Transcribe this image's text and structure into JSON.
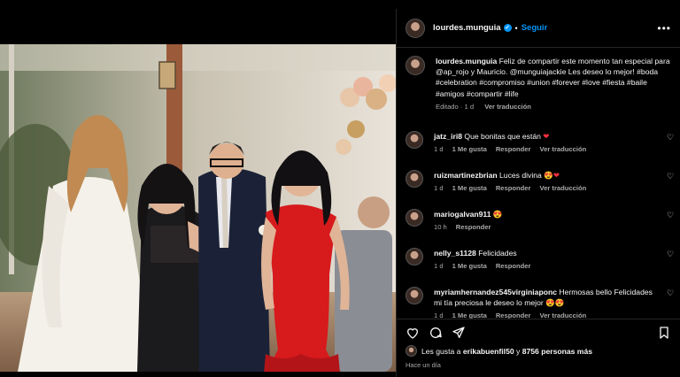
{
  "post": {
    "username": "lourdes.munguia",
    "follow_label": "Seguir",
    "more_label": "•••",
    "separator": "•",
    "caption": {
      "username": "lourdes.munguia",
      "text": "Feliz de compartir este momento tan especial para @ap_rojo y Mauricio. @munguiajackie Les deseo lo mejor! #boda #celebration #compromiso #union #forever #love #fiesta #baile #amigos #compartir #life",
      "edited": "Editado · 1 d",
      "translation": "Ver traducción"
    }
  },
  "comments": [
    {
      "username": "jatz_iri8",
      "text": "Que bonitas que están",
      "emoji": "❤",
      "time": "1 d",
      "likes": "1 Me gusta",
      "reply": "Responder",
      "translation": "Ver traducción"
    },
    {
      "username": "ruizmartinezbrian",
      "text": "Luces divina",
      "emoji": "😍❤",
      "time": "1 d",
      "likes": "1 Me gusta",
      "reply": "Responder",
      "translation": "Ver traducción"
    },
    {
      "username": "mariogalvan911",
      "text": "",
      "emoji": "😍",
      "time": "10 h",
      "likes": "",
      "reply": "Responder",
      "translation": ""
    },
    {
      "username": "nelly_s1128",
      "text": "Felicidades",
      "emoji": "",
      "time": "1 d",
      "likes": "1 Me gusta",
      "reply": "Responder",
      "translation": ""
    },
    {
      "username": "myriamhernandez545virginiaponc",
      "text": "Hermosas bello Felicidades mi tía preciosa le deseo lo mejor",
      "emoji": "😍😍",
      "time": "1 d",
      "likes": "1 Me gusta",
      "reply": "Responder",
      "translation": "Ver traducción"
    }
  ],
  "likes": {
    "prefix": "Les gusta a",
    "user": "erikabuenfil50",
    "joiner": "y",
    "others": "8756 personas más"
  },
  "ago": "Hace un día",
  "colors": {
    "accent": "#0095f6",
    "heart": "#ff3040",
    "secondary": "#a8a8a8"
  }
}
